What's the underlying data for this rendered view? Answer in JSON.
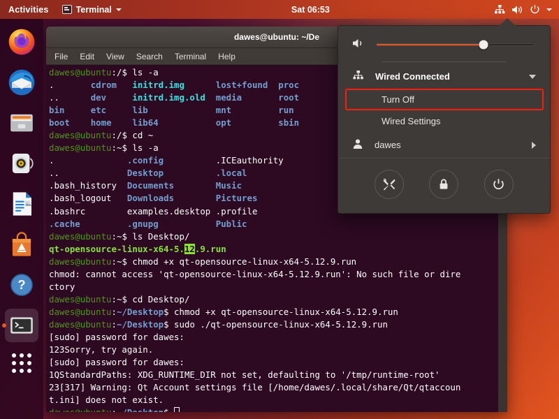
{
  "topbar": {
    "activities": "Activities",
    "app_name": "Terminal",
    "app_icon": "terminal-icon",
    "clock": "Sat 06:53",
    "indicators": [
      "network-wired-icon",
      "volume-icon",
      "power-icon",
      "chevron-down-icon"
    ]
  },
  "dock": {
    "items": [
      {
        "name": "firefox",
        "label": "Firefox",
        "active": false
      },
      {
        "name": "thunderbird",
        "label": "Thunderbird Mail",
        "active": false
      },
      {
        "name": "files",
        "label": "Files",
        "active": false
      },
      {
        "name": "rhythmbox",
        "label": "Rhythmbox",
        "active": false
      },
      {
        "name": "libreoffice-writer",
        "label": "LibreOffice Writer",
        "active": false
      },
      {
        "name": "ubuntu-software",
        "label": "Ubuntu Software",
        "active": false
      },
      {
        "name": "help",
        "label": "Help",
        "active": false
      },
      {
        "name": "terminal",
        "label": "Terminal",
        "active": true
      }
    ],
    "show_apps_label": "Show Applications"
  },
  "terminal": {
    "title": "dawes@ubuntu: ~/De",
    "menu": [
      "File",
      "Edit",
      "View",
      "Search",
      "Terminal",
      "Help"
    ],
    "lines": [
      {
        "segs": [
          {
            "t": "dawes@ubuntu",
            "c": "g"
          },
          {
            "t": ":/$ ls -a",
            "c": "w"
          }
        ]
      },
      {
        "segs": [
          {
            "t": ".       ",
            "c": "w"
          },
          {
            "t": "cdrom   ",
            "c": "b"
          },
          {
            "t": "initrd.img      ",
            "c": "c"
          },
          {
            "t": "lost+found  ",
            "c": "b"
          },
          {
            "t": "proc",
            "c": "b"
          }
        ]
      },
      {
        "segs": [
          {
            "t": "..      ",
            "c": "w"
          },
          {
            "t": "dev     ",
            "c": "b"
          },
          {
            "t": "initrd.img.old  ",
            "c": "c"
          },
          {
            "t": "media       ",
            "c": "b"
          },
          {
            "t": "root",
            "c": "b"
          }
        ]
      },
      {
        "segs": [
          {
            "t": "bin     ",
            "c": "b"
          },
          {
            "t": "etc     ",
            "c": "b"
          },
          {
            "t": "lib             ",
            "c": "b"
          },
          {
            "t": "mnt         ",
            "c": "b"
          },
          {
            "t": "run",
            "c": "b"
          }
        ]
      },
      {
        "segs": [
          {
            "t": "boot    ",
            "c": "b"
          },
          {
            "t": "home    ",
            "c": "b"
          },
          {
            "t": "lib64           ",
            "c": "b"
          },
          {
            "t": "opt         ",
            "c": "b"
          },
          {
            "t": "sbin",
            "c": "b"
          }
        ]
      },
      {
        "segs": [
          {
            "t": "dawes@ubuntu",
            "c": "g"
          },
          {
            "t": ":/$ cd ~",
            "c": "w"
          }
        ]
      },
      {
        "segs": [
          {
            "t": "dawes@ubuntu",
            "c": "g"
          },
          {
            "t": ":~$ ls -a",
            "c": "w"
          }
        ]
      },
      {
        "segs": [
          {
            "t": ".              ",
            "c": "w"
          },
          {
            "t": ".config          ",
            "c": "b"
          },
          {
            "t": ".ICEauthority",
            "c": "w"
          }
        ]
      },
      {
        "segs": [
          {
            "t": "..             ",
            "c": "w"
          },
          {
            "t": "Desktop          ",
            "c": "b"
          },
          {
            "t": ".local",
            "c": "b"
          }
        ]
      },
      {
        "segs": [
          {
            "t": ".bash_history  ",
            "c": "w"
          },
          {
            "t": "Documents        ",
            "c": "b"
          },
          {
            "t": "Music",
            "c": "b"
          }
        ]
      },
      {
        "segs": [
          {
            "t": ".bash_logout   ",
            "c": "w"
          },
          {
            "t": "Downloads        ",
            "c": "b"
          },
          {
            "t": "Pictures",
            "c": "b"
          }
        ]
      },
      {
        "segs": [
          {
            "t": ".bashrc        ",
            "c": "w"
          },
          {
            "t": "examples.desktop ",
            "c": "w"
          },
          {
            "t": ".profile",
            "c": "w"
          }
        ]
      },
      {
        "segs": [
          {
            "t": ".cache         ",
            "c": "b"
          },
          {
            "t": ".gnupg           ",
            "c": "b"
          },
          {
            "t": "Public",
            "c": "b"
          }
        ]
      },
      {
        "segs": [
          {
            "t": "dawes@ubuntu",
            "c": "g"
          },
          {
            "t": ":~$ ls Desktop/",
            "c": "w"
          }
        ]
      },
      {
        "segs": [
          {
            "t": "qt-opensource-linux-x64-5.",
            "c": "pg"
          },
          {
            "t": "12",
            "c": "sel"
          },
          {
            "t": ".9.run",
            "c": "pg"
          }
        ]
      },
      {
        "segs": [
          {
            "t": "dawes@ubuntu",
            "c": "g"
          },
          {
            "t": ":~$ chmod +x qt-opensource-linux-x64-5.12.9.run",
            "c": "w"
          }
        ]
      },
      {
        "segs": [
          {
            "t": "chmod: cannot access 'qt-opensource-linux-x64-5.12.9.run': No such file or dire",
            "c": "w"
          }
        ]
      },
      {
        "segs": [
          {
            "t": "ctory",
            "c": "w"
          }
        ]
      },
      {
        "segs": [
          {
            "t": "dawes@ubuntu",
            "c": "g"
          },
          {
            "t": ":~$ cd Desktop/",
            "c": "w"
          }
        ]
      },
      {
        "segs": [
          {
            "t": "dawes@ubuntu",
            "c": "g"
          },
          {
            "t": ":",
            "c": "w"
          },
          {
            "t": "~/Desktop",
            "c": "b"
          },
          {
            "t": "$ chmod +x qt-opensource-linux-x64-5.12.9.run",
            "c": "w"
          }
        ]
      },
      {
        "segs": [
          {
            "t": "dawes@ubuntu",
            "c": "g"
          },
          {
            "t": ":",
            "c": "w"
          },
          {
            "t": "~/Desktop",
            "c": "b"
          },
          {
            "t": "$ sudo ./qt-opensource-linux-x64-5.12.9.run",
            "c": "w"
          }
        ]
      },
      {
        "segs": [
          {
            "t": "[sudo] password for dawes:",
            "c": "w"
          }
        ]
      },
      {
        "segs": [
          {
            "t": "123Sorry, try again.",
            "c": "w"
          }
        ]
      },
      {
        "segs": [
          {
            "t": "[sudo] password for dawes:",
            "c": "w"
          }
        ]
      },
      {
        "segs": [
          {
            "t": "1QStandardPaths: XDG_RUNTIME_DIR not set, defaulting to '/tmp/runtime-root'",
            "c": "w"
          }
        ]
      },
      {
        "segs": [
          {
            "t": "23[317] Warning: Qt Account settings file [/home/dawes/.local/share/Qt/qtaccoun",
            "c": "w"
          }
        ]
      },
      {
        "segs": [
          {
            "t": "t.ini] does not exist.",
            "c": "w"
          }
        ]
      },
      {
        "segs": [
          {
            "t": "dawes@ubuntu",
            "c": "g"
          },
          {
            "t": ":",
            "c": "w"
          },
          {
            "t": "~/Desktop",
            "c": "b"
          },
          {
            "t": "$ ",
            "c": "w"
          },
          {
            "t": "",
            "c": "cursor"
          }
        ]
      }
    ]
  },
  "sysmenu": {
    "volume": {
      "icon": "volume-icon",
      "percent": 68
    },
    "network": {
      "icon": "network-wired-icon",
      "label": "Wired Connected",
      "expand_icon": "chevron-down-icon"
    },
    "network_items": [
      {
        "label": "Turn Off",
        "highlighted": true
      },
      {
        "label": "Wired Settings",
        "highlighted": false
      }
    ],
    "user": {
      "icon": "user-icon",
      "label": "dawes",
      "expand_icon": "chevron-right-icon"
    },
    "actions": [
      {
        "name": "settings-button",
        "icon": "tools-icon"
      },
      {
        "name": "lock-button",
        "icon": "lock-icon"
      },
      {
        "name": "power-button",
        "icon": "power-icon"
      }
    ],
    "highlight_color": "#ff1b0e",
    "accent_color": "#e95420"
  }
}
